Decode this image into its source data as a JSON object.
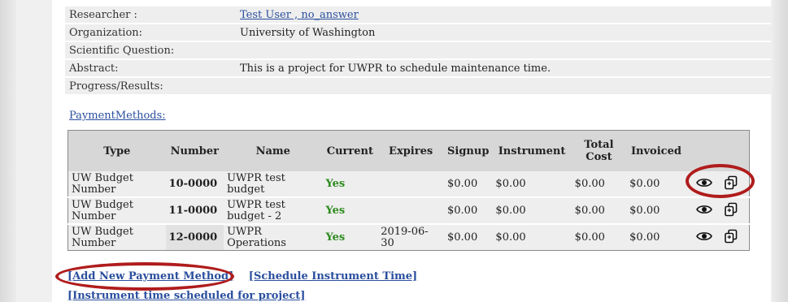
{
  "project": {
    "rows": [
      {
        "label": "Researcher :",
        "value": "Test User , no_answer",
        "link": true
      },
      {
        "label": "Organization:",
        "value": "University of Washington"
      },
      {
        "label": "Scientific Question:",
        "value": ""
      },
      {
        "label": "Abstract:",
        "value": "This is a project for UWPR to schedule maintenance time."
      },
      {
        "label": "Progress/Results:",
        "value": ""
      }
    ]
  },
  "payment": {
    "section_label": "PaymentMethods:",
    "headers": [
      "Type",
      "Number",
      "Name",
      "Current",
      "Expires",
      "Signup",
      "Instrument",
      "Total Cost",
      "Invoiced"
    ],
    "rows": [
      {
        "type": "UW Budget Number",
        "number": "10-0000",
        "name": "UWPR test budget",
        "current": "Yes",
        "expires": "",
        "signup": "$0.00",
        "instrument": "$0.00",
        "total_cost": "$0.00",
        "invoiced": "$0.00"
      },
      {
        "type": "UW Budget Number",
        "number": "11-0000",
        "name": "UWPR test budget - 2",
        "current": "Yes",
        "expires": "",
        "signup": "$0.00",
        "instrument": "$0.00",
        "total_cost": "$0.00",
        "invoiced": "$0.00"
      },
      {
        "type": "UW Budget Number",
        "number": "12-0000",
        "name": "UWPR Operations",
        "current": "Yes",
        "expires": "2019-06-30",
        "signup": "$0.00",
        "instrument": "$0.00",
        "total_cost": "$0.00",
        "invoiced": "$0.00"
      }
    ],
    "row_icons": [
      "eye-icon",
      "copy-icon"
    ]
  },
  "actions": {
    "add_payment": "[Add New Payment Method]",
    "schedule_time": "[Schedule Instrument Time]",
    "instrument_time": "[Instrument time scheduled for project]"
  },
  "colors": {
    "highlight_ring": "#b01c1c",
    "link": "#2a4f9e",
    "current_yes": "#2e8b1f"
  }
}
